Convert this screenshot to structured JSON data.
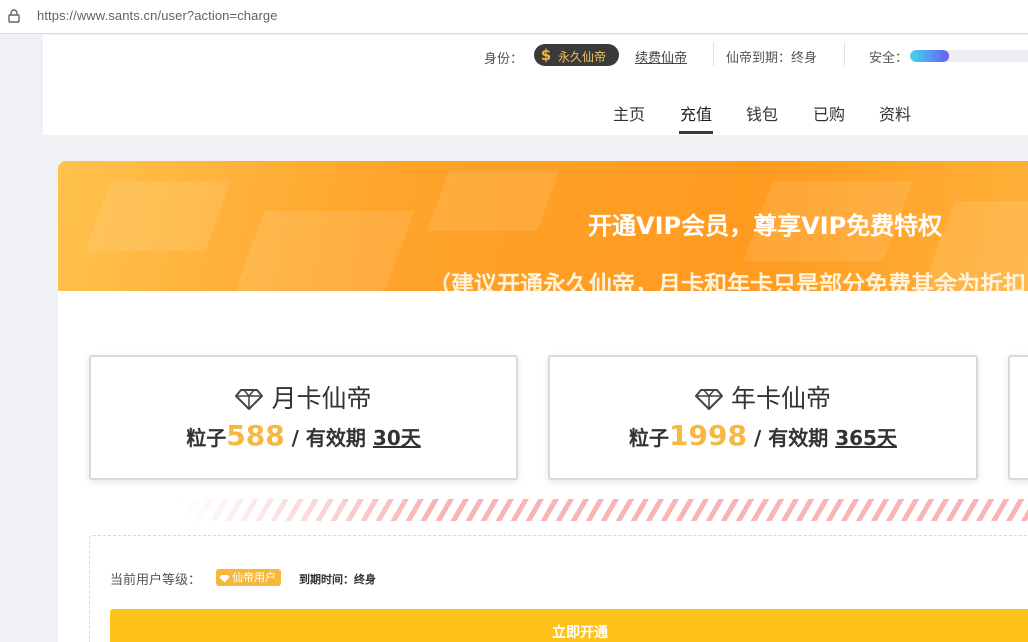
{
  "browser": {
    "url": "https://www.sants.cn/user?action=charge"
  },
  "header": {
    "identity_label": "身份：",
    "identity_badge": "永久仙帝",
    "renew_link": "续费仙帝",
    "expire_text": "仙帝到期：终身",
    "safety_label": "安全：",
    "safety_level": 0.3
  },
  "nav": {
    "items": [
      "主页",
      "充值",
      "钱包",
      "已购",
      "资料"
    ],
    "active": "充值"
  },
  "banner": {
    "title": "开通VIP会员，尊享VIP免费特权",
    "subtitle": "（建议开通永久仙帝，月卡和年卡只是部分免费其余为折扣"
  },
  "plans": [
    {
      "name": "月卡仙帝",
      "price_prefix": "粒子",
      "price": "588",
      "validity_label": " / 有效期 ",
      "validity": "30天"
    },
    {
      "name": "年卡仙帝",
      "price_prefix": "粒子",
      "price": "1998",
      "validity_label": " / 有效期 ",
      "validity": "365天"
    }
  ],
  "status": {
    "current_level_label": "当前用户等级：",
    "level_badge": "仙帝用户",
    "expiry": "到期时间：终身",
    "open_button": "立即开通"
  },
  "colors": {
    "accent_gold": "#f5b943",
    "button_yellow": "#ffc21a",
    "banner_orange": "#ffa32a"
  }
}
